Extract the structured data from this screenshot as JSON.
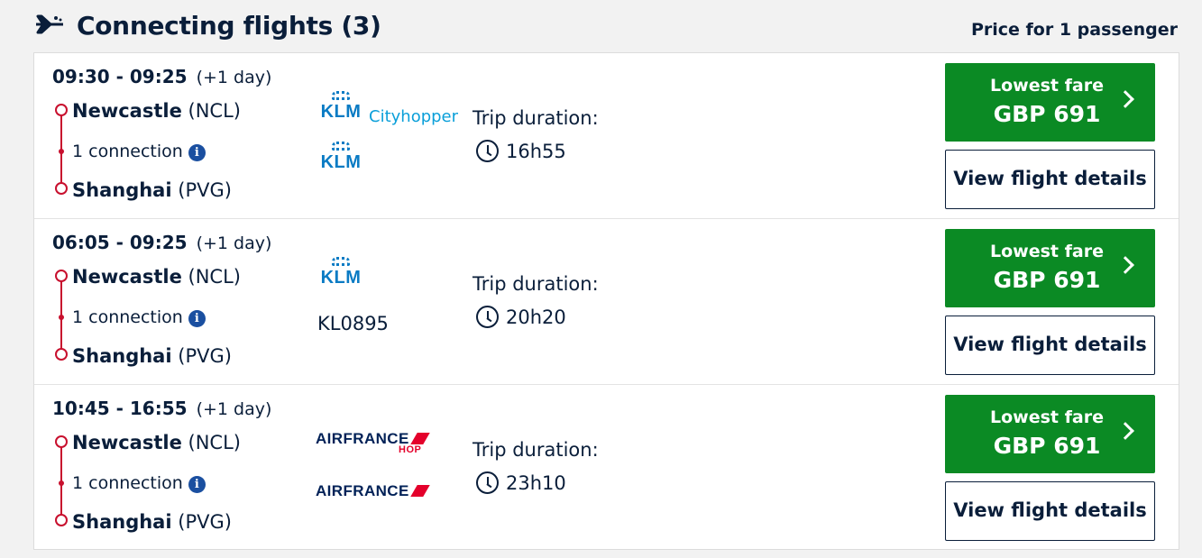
{
  "header": {
    "title": "Connecting flights (3)",
    "price_note": "Price for 1 passenger",
    "icon": "plane-icon"
  },
  "colors": {
    "fare_green": "#0b8a24",
    "route_red": "#c8102e",
    "text_navy": "#0a1e3a",
    "klm_blue": "#0a7bc4",
    "af_navy": "#002157",
    "af_red": "#e4002b"
  },
  "flights": [
    {
      "times": "09:30 - 09:25",
      "day_offset": "(+1 day)",
      "origin_city": "Newcastle",
      "origin_code": "(NCL)",
      "connection": "1 connection",
      "dest_city": "Shanghai",
      "dest_code": "(PVG)",
      "airline_logos": [
        "KLM Cityhopper",
        "KLM"
      ],
      "logo_text": {
        "klm": "KLM",
        "cityhopper": "Cityhopper"
      },
      "duration_label": "Trip duration:",
      "duration": "16h55",
      "fare_label": "Lowest fare",
      "fare_price": "GBP 691",
      "details_label": "View flight details"
    },
    {
      "times": "06:05 - 09:25",
      "day_offset": "(+1 day)",
      "origin_city": "Newcastle",
      "origin_code": "(NCL)",
      "connection": "1 connection",
      "dest_city": "Shanghai",
      "dest_code": "(PVG)",
      "airline_logos": [
        "KLM"
      ],
      "logo_text": {
        "klm": "KLM"
      },
      "flight_number": "KL0895",
      "duration_label": "Trip duration:",
      "duration": "20h20",
      "fare_label": "Lowest fare",
      "fare_price": "GBP 691",
      "details_label": "View flight details"
    },
    {
      "times": "10:45 - 16:55",
      "day_offset": "(+1 day)",
      "origin_city": "Newcastle",
      "origin_code": "(NCL)",
      "connection": "1 connection",
      "dest_city": "Shanghai",
      "dest_code": "(PVG)",
      "airline_logos": [
        "Air France HOP",
        "Air France"
      ],
      "logo_text": {
        "airfrance": "AIRFRANCE",
        "hop": "HOP"
      },
      "duration_label": "Trip duration:",
      "duration": "23h10",
      "fare_label": "Lowest fare",
      "fare_price": "GBP 691",
      "details_label": "View flight details"
    }
  ]
}
